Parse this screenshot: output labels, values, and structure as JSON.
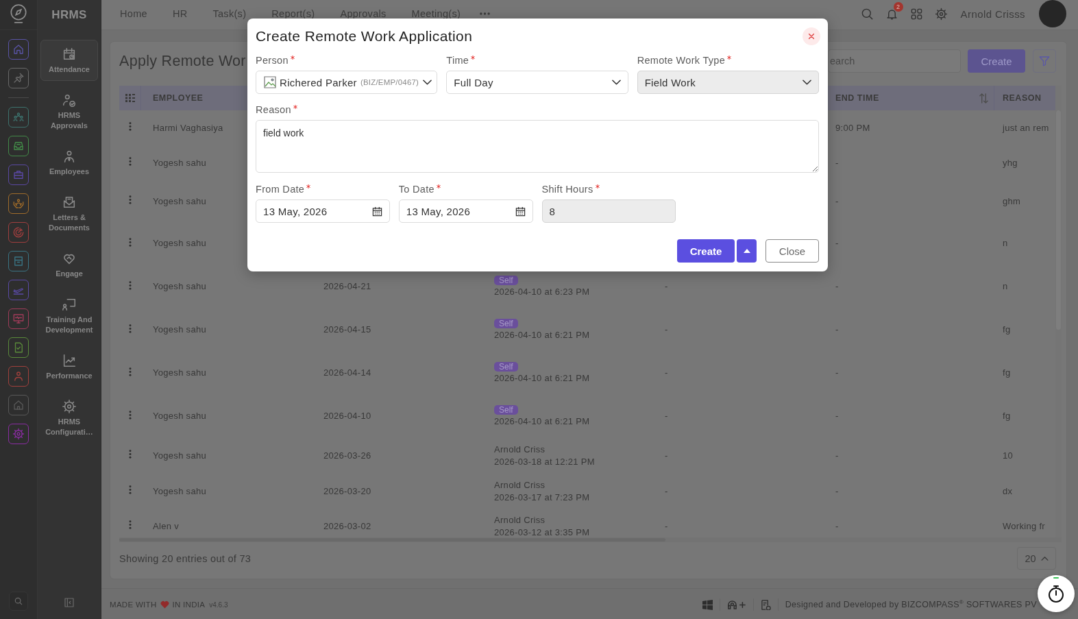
{
  "rail": {
    "items": [
      {
        "kind": "home",
        "color": "#5a54a6"
      },
      {
        "kind": "pin",
        "color": "#686868"
      },
      {
        "kind": "people",
        "color": "#3d726d"
      },
      {
        "kind": "tray",
        "color": "#428a48"
      },
      {
        "kind": "briefcase",
        "color": "#5a48a2"
      },
      {
        "kind": "hands",
        "color": "#a06c2a"
      },
      {
        "kind": "target",
        "color": "#a03e3e"
      },
      {
        "kind": "archive",
        "color": "#3a7484"
      },
      {
        "kind": "plane",
        "color": "#5a4aa6"
      },
      {
        "kind": "monitor",
        "color": "#a03c5a"
      },
      {
        "kind": "document",
        "color": "#5a8a3a"
      },
      {
        "kind": "person",
        "color": "#a0403c"
      },
      {
        "kind": "house",
        "color": "#585858"
      },
      {
        "kind": "gear",
        "color": "#8a2ca2"
      }
    ]
  },
  "sidebar": {
    "title": "HRMS",
    "items": [
      {
        "kind": "calendar",
        "label": "Attendance",
        "selected": true
      },
      {
        "kind": "approval",
        "label": "HRMS Approvals",
        "selected": false
      },
      {
        "kind": "employee",
        "label": "Employees",
        "selected": false
      },
      {
        "kind": "letters",
        "label": "Letters & Documents",
        "selected": false
      },
      {
        "kind": "engage",
        "label": "Engage",
        "selected": false
      },
      {
        "kind": "training",
        "label": "Training And Development",
        "selected": false
      },
      {
        "kind": "performance",
        "label": "Performance",
        "selected": false
      },
      {
        "kind": "settings",
        "label": "HRMS Configurati…",
        "selected": false
      }
    ]
  },
  "header": {
    "nav": [
      {
        "label": "Home"
      },
      {
        "label": "HR"
      },
      {
        "label": "Task(s)"
      },
      {
        "label": "Report(s)"
      },
      {
        "label": "Approvals"
      },
      {
        "label": "Meeting(s)"
      }
    ],
    "notifications": "2",
    "user": "Arnold Crisss"
  },
  "page": {
    "title": "Apply Remote Wor",
    "search": {
      "placeholder": "earch"
    },
    "create_button": "Create",
    "entries": "Showing 20 entries out of 73",
    "page_size": "20"
  },
  "table": {
    "columns": [
      {
        "label": "EMPLOYEE",
        "sortable": false
      },
      {
        "label": "END TIME",
        "sortable": true
      },
      {
        "label": "REASON",
        "sortable": false
      }
    ],
    "rows": [
      {
        "employee": "Harmi Vaghasiya",
        "end_time": "9:00 PM",
        "reason": "just an rem"
      },
      {
        "employee": "Yogesh sahu",
        "end_time": "-",
        "reason": "yhg"
      },
      {
        "employee": "Yogesh sahu",
        "end_time": "-",
        "reason": "ghm"
      },
      {
        "employee": "Yogesh sahu",
        "end_time": "-",
        "reason": "n"
      },
      {
        "employee": "Yogesh sahu",
        "column_3": "2026-04-21",
        "column_4": {
          "kind": "badge",
          "label": "Self",
          "time": "2026-04-10 at 6:23 PM"
        },
        "column_5": "-",
        "end_time": "-",
        "reason": "n"
      },
      {
        "employee": "Yogesh sahu",
        "column_3": "2026-04-15",
        "column_4": {
          "kind": "badge",
          "label": "Self",
          "time": "2026-04-10 at 6:21 PM"
        },
        "column_5": "-",
        "end_time": "-",
        "reason": "fg"
      },
      {
        "employee": "Yogesh sahu",
        "column_3": "2026-04-14",
        "column_4": {
          "kind": "badge",
          "label": "Self",
          "time": "2026-04-10 at 6:21 PM"
        },
        "column_5": "-",
        "end_time": "-",
        "reason": "fg"
      },
      {
        "employee": "Yogesh sahu",
        "column_3": "2026-04-10",
        "column_4": {
          "kind": "badge",
          "label": "Self",
          "time": "2026-04-10 at 6:21 PM"
        },
        "column_5": "-",
        "end_time": "-",
        "reason": "fg"
      },
      {
        "employee": "Yogesh sahu",
        "column_3": "2026-03-26",
        "column_4": {
          "kind": "name",
          "label": "Arnold Criss",
          "time": "2026-03-18 at 12:21 PM"
        },
        "column_5": "-",
        "end_time": "-",
        "reason": "10"
      },
      {
        "employee": "Yogesh sahu",
        "column_3": "2026-03-20",
        "column_4": {
          "kind": "name",
          "label": "Arnold Criss",
          "time": "2026-03-17 at 7:23 PM"
        },
        "column_5": "-",
        "end_time": "-",
        "reason": "dx"
      },
      {
        "employee": "Alen v",
        "column_3": "2026-03-02",
        "column_4": {
          "kind": "name",
          "label": "Arnold Criss",
          "time": "2026-03-12 at 3:35 PM"
        },
        "column_5": "-",
        "end_time": "-",
        "reason": "Working fr"
      }
    ]
  },
  "footer": {
    "made_with": "MADE WITH",
    "in_india": "IN INDIA",
    "version": "v4.6.3",
    "credit": "Designed and Developed by BIZCOMPASS$^{®}$ SOFTWARES PV"
  },
  "dialog": {
    "title": "Create Remote Work Application",
    "form_rows": [
      [
        {
          "kind": "person",
          "label": "Person",
          "required": true,
          "disabled": false,
          "value": "Richered Parker",
          "code": "(BIZ/EMP/0467)"
        },
        {
          "kind": "select",
          "label": "Time",
          "required": true,
          "disabled": false,
          "value": "Full Day"
        },
        {
          "kind": "select",
          "label": "Remote Work Type",
          "required": true,
          "disabled": true,
          "value": "Field Work"
        }
      ],
      [
        {
          "kind": "textarea",
          "label": "Reason",
          "required": true,
          "disabled": false,
          "value": "field work"
        }
      ],
      [
        {
          "kind": "date",
          "label": "From Date",
          "required": true,
          "disabled": false,
          "value": "13 May, 2026"
        },
        {
          "kind": "date",
          "label": "To Date",
          "required": true,
          "disabled": false,
          "value": "13 May, 2026"
        },
        {
          "kind": "number",
          "label": "Shift Hours",
          "required": true,
          "disabled": true,
          "value": "8"
        }
      ]
    ],
    "buttons": [
      {
        "kind": "split",
        "label": "Create"
      },
      {
        "kind": "secondary",
        "label": "Close"
      }
    ]
  }
}
